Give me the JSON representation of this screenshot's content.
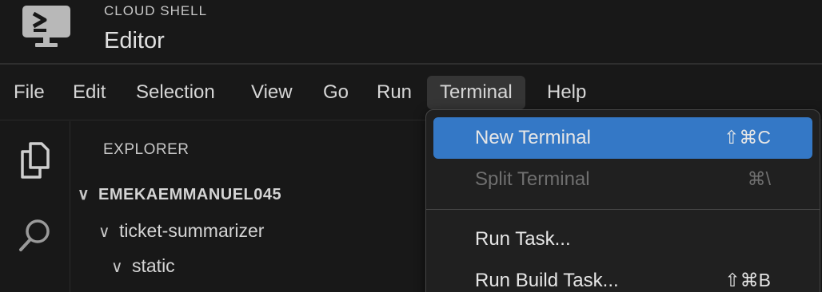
{
  "header": {
    "brand_sub": "CLOUD SHELL",
    "brand_title": "Editor",
    "logo_icon": "terminal-monitor-icon"
  },
  "menubar": {
    "items": [
      "File",
      "Edit",
      "Selection",
      "View",
      "Go",
      "Run",
      "Terminal",
      "Help"
    ],
    "active": "Terminal"
  },
  "activitybar": {
    "icons": [
      "explorer-files-icon",
      "search-icon"
    ]
  },
  "sidebar": {
    "title": "EXPLORER",
    "tree": [
      {
        "label": "EMEKAEMMANUEL045",
        "expanded": true
      },
      {
        "label": "ticket-summarizer",
        "expanded": true
      },
      {
        "label": "static",
        "expanded": true
      }
    ]
  },
  "terminal_menu": {
    "items": [
      {
        "label": "New Terminal",
        "shortcut": "⇧⌘C",
        "highlighted": true,
        "disabled": false
      },
      {
        "label": "Split Terminal",
        "shortcut": "⌘\\",
        "highlighted": false,
        "disabled": true
      },
      {
        "label": "Run Task...",
        "shortcut": "",
        "highlighted": false,
        "disabled": false
      },
      {
        "label": "Run Build Task...",
        "shortcut": "⇧⌘B",
        "highlighted": false,
        "disabled": false
      }
    ]
  },
  "colors": {
    "highlight": "#3478c6",
    "background": "#181818"
  }
}
